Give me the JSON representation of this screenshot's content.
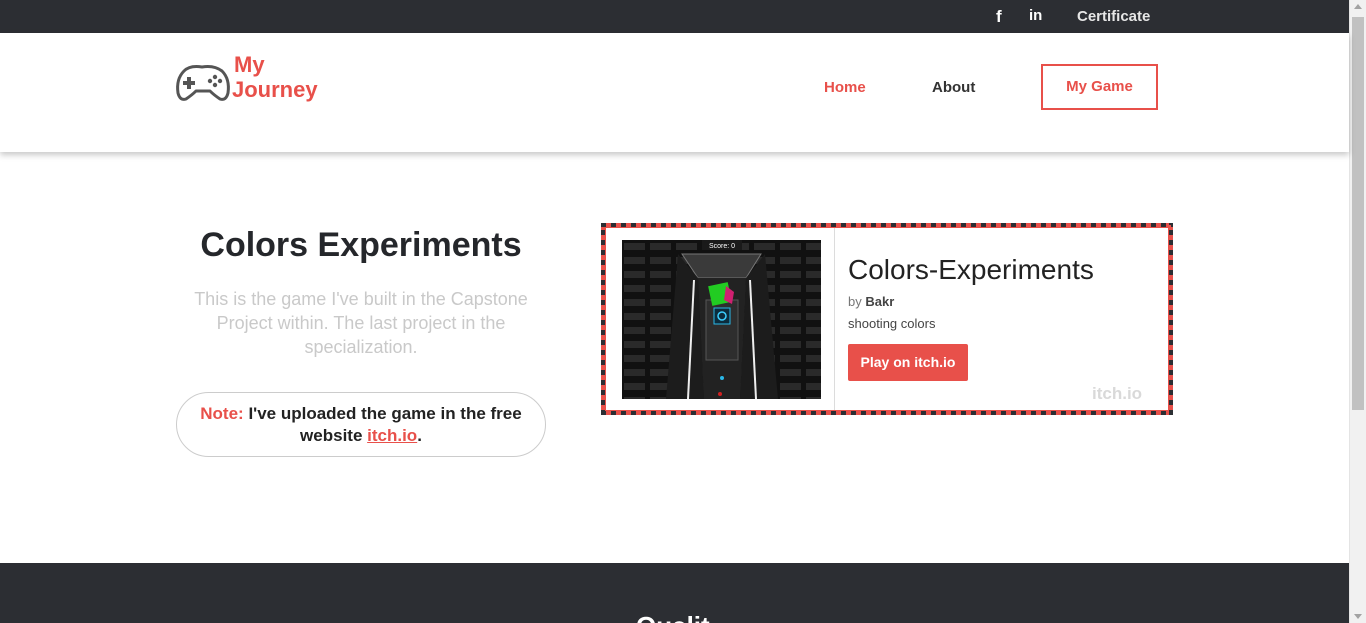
{
  "topbar": {
    "facebook_icon": "facebook-icon",
    "linkedin_icon": "linkedin-icon",
    "certificate_label": "Certificate"
  },
  "logo": {
    "line1": "My",
    "line2": "Journey",
    "icon": "gamepad-icon"
  },
  "nav": {
    "home": "Home",
    "about": "About",
    "my_game": "My Game"
  },
  "main": {
    "title": "Colors Experiments",
    "description": "This is the game I've built in the Capstone Project within. The last project in the specialization.",
    "note_label": "Note:",
    "note_text_before": " I've uploaded the game in the free website ",
    "note_link": "itch.io",
    "note_text_after": "."
  },
  "widget": {
    "game_title": "Colors-Experiments",
    "by_prefix": "by",
    "author": "Bakr",
    "tagline": "shooting colors",
    "play_button": "Play on itch.io",
    "brand": "itch.io",
    "screenshot_score_label": "Score: 0"
  },
  "footer": {
    "heading_partial": "Qualit"
  },
  "colors": {
    "accent": "#e8504a",
    "dark": "#2c2e33"
  }
}
